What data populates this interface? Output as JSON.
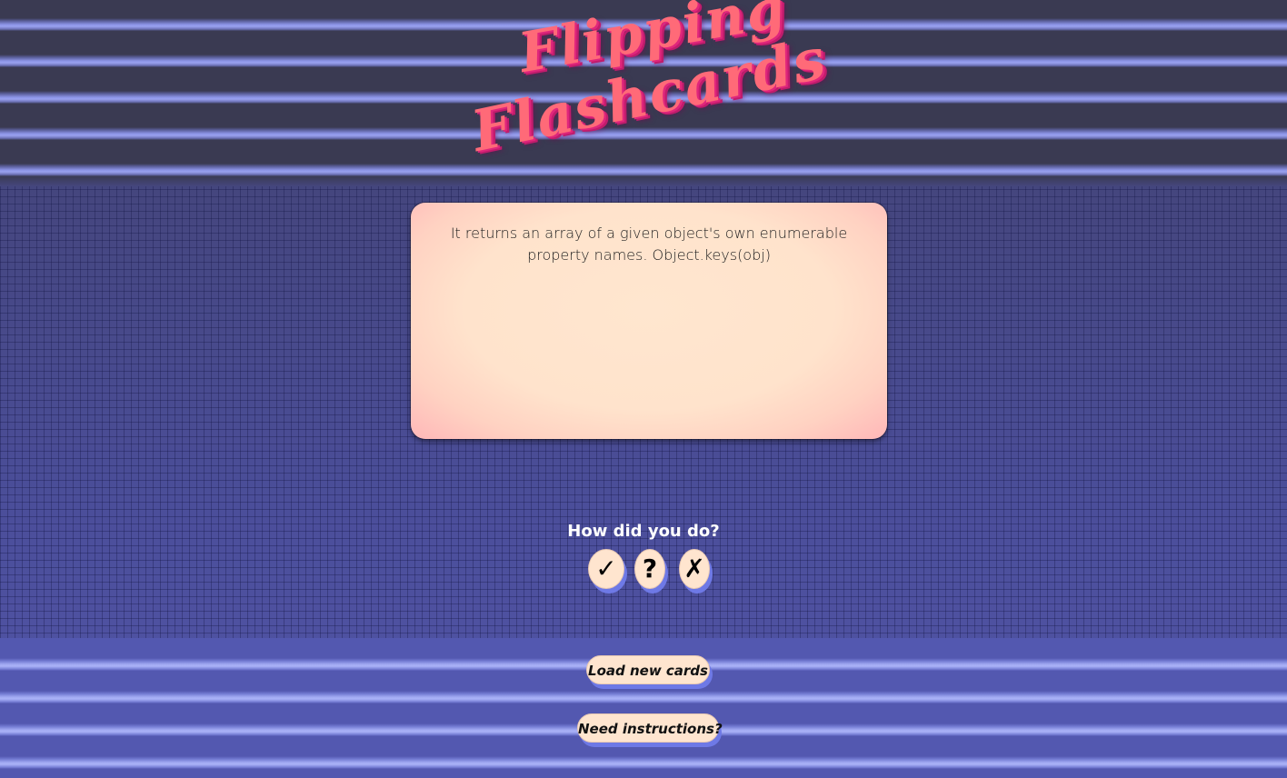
{
  "app": {
    "title_line1": "Flipping",
    "title_line2": "Flashcards"
  },
  "card": {
    "text": "It returns an array of a given object's own enumerable property names. Object.keys(obj)"
  },
  "rating": {
    "prompt": "How did you do?",
    "buttons": [
      {
        "label": "✓",
        "icon": "check-icon"
      },
      {
        "label": "?",
        "icon": "question-icon"
      },
      {
        "label": "✗",
        "icon": "cross-icon"
      }
    ]
  },
  "actions": {
    "load_label": "Load new cards",
    "help_label": "Need instructions?"
  },
  "colors": {
    "title": "#ff6a78",
    "title_shadow": "#e0267c",
    "card": "#ffe3cc",
    "button_fill": "#ffe5cf",
    "button_shadow": "#6e79e6"
  }
}
